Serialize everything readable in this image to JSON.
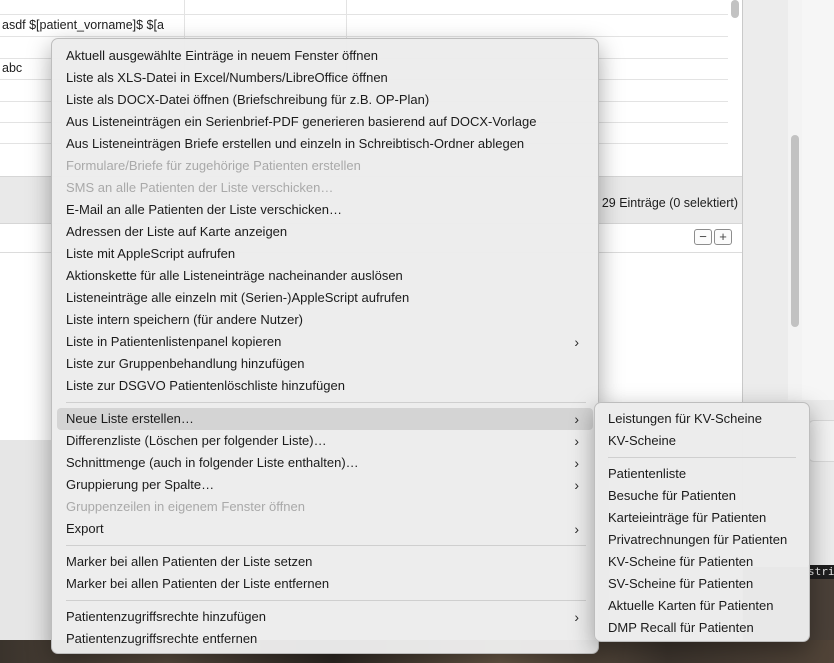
{
  "table": {
    "rows": [
      {
        "text": ""
      },
      {
        "text": "asdf $[patient_vorname]$ $[a"
      },
      {
        "text": ""
      },
      {
        "text": "abc"
      },
      {
        "text": ""
      },
      {
        "text": ""
      },
      {
        "text": ""
      }
    ]
  },
  "status": {
    "entry_count": "29 Einträge (0 selektiert)",
    "minus_label": "−",
    "plus_label": "+"
  },
  "snippet": {
    "text": "strin"
  },
  "menu": {
    "items": [
      {
        "label": "Aktuell ausgewählte Einträge in neuem Fenster öffnen",
        "enabled": true,
        "submenu": false
      },
      {
        "label": "Liste als XLS-Datei in Excel/Numbers/LibreOffice öffnen",
        "enabled": true,
        "submenu": false
      },
      {
        "label": "Liste als DOCX-Datei öffnen (Briefschreibung für z.B. OP-Plan)",
        "enabled": true,
        "submenu": false
      },
      {
        "label": "Aus Listeneinträgen ein Serienbrief-PDF generieren basierend auf DOCX-Vorlage",
        "enabled": true,
        "submenu": false
      },
      {
        "label": "Aus Listeneinträgen Briefe erstellen und einzeln in Schreibtisch-Ordner ablegen",
        "enabled": true,
        "submenu": false
      },
      {
        "label": "Formulare/Briefe für zugehörige Patienten erstellen",
        "enabled": false,
        "submenu": false
      },
      {
        "label": "SMS an alle Patienten der Liste verschicken…",
        "enabled": false,
        "submenu": false
      },
      {
        "label": "E-Mail an alle Patienten der Liste verschicken…",
        "enabled": true,
        "submenu": false
      },
      {
        "label": "Adressen der Liste auf Karte anzeigen",
        "enabled": true,
        "submenu": false
      },
      {
        "label": "Liste mit AppleScript aufrufen",
        "enabled": true,
        "submenu": false
      },
      {
        "label": "Aktionskette für alle Listeneinträge nacheinander auslösen",
        "enabled": true,
        "submenu": false
      },
      {
        "label": "Listeneinträge alle einzeln mit (Serien-)AppleScript aufrufen",
        "enabled": true,
        "submenu": false
      },
      {
        "label": "Liste intern speichern (für andere Nutzer)",
        "enabled": true,
        "submenu": false
      },
      {
        "label": "Liste in Patientenlistenpanel kopieren",
        "enabled": true,
        "submenu": true
      },
      {
        "label": "Liste zur Gruppenbehandlung hinzufügen",
        "enabled": true,
        "submenu": false
      },
      {
        "label": "Liste zur DSGVO Patientenlöschliste hinzufügen",
        "enabled": true,
        "submenu": false
      },
      {
        "label": "Neue Liste erstellen…",
        "enabled": true,
        "submenu": true,
        "active": true
      },
      {
        "label": "Differenzliste (Löschen per folgender Liste)…",
        "enabled": true,
        "submenu": true
      },
      {
        "label": "Schnittmenge (auch in folgender Liste enthalten)…",
        "enabled": true,
        "submenu": true
      },
      {
        "label": "Gruppierung per Spalte…",
        "enabled": true,
        "submenu": true
      },
      {
        "label": "Gruppenzeilen in eigenem Fenster öffnen",
        "enabled": false,
        "submenu": false
      },
      {
        "label": "Export",
        "enabled": true,
        "submenu": true
      },
      {
        "label": "Marker bei allen Patienten der Liste setzen",
        "enabled": true,
        "submenu": false
      },
      {
        "label": "Marker bei allen Patienten der Liste entfernen",
        "enabled": true,
        "submenu": false
      },
      {
        "label": "Patientenzugriffsrechte hinzufügen",
        "enabled": true,
        "submenu": true
      },
      {
        "label": "Patientenzugriffsrechte entfernen",
        "enabled": true,
        "submenu": false
      }
    ],
    "chevron": "›"
  },
  "submenu": {
    "items": [
      {
        "label": "Leistungen für KV-Scheine"
      },
      {
        "label": "KV-Scheine"
      },
      {
        "label": "Patientenliste"
      },
      {
        "label": "Besuche für Patienten"
      },
      {
        "label": "Karteieinträge für Patienten"
      },
      {
        "label": "Privatrechnungen für Patienten"
      },
      {
        "label": "KV-Scheine für Patienten"
      },
      {
        "label": "SV-Scheine für Patienten"
      },
      {
        "label": "Aktuelle Karten für Patienten"
      },
      {
        "label": "DMP Recall für Patienten"
      }
    ]
  }
}
